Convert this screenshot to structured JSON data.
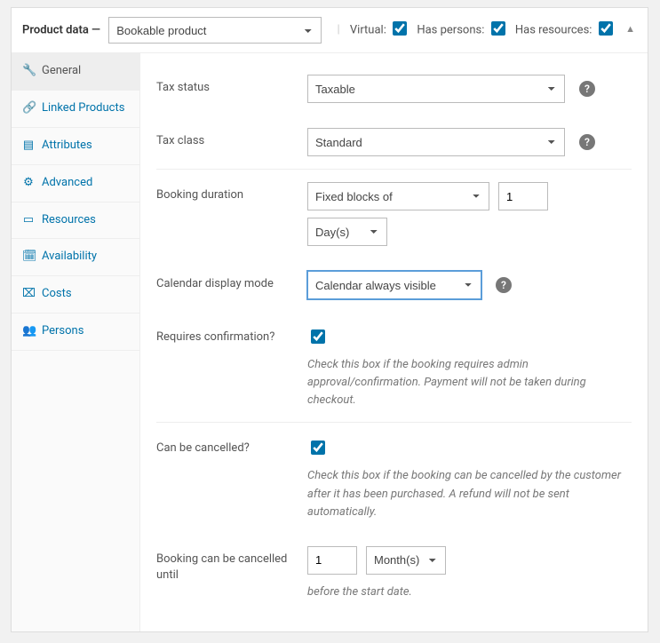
{
  "header": {
    "title": "Product data —",
    "product_type": "Bookable product",
    "options": {
      "virtual_label": "Virtual:",
      "virtual_checked": true,
      "persons_label": "Has persons:",
      "persons_checked": true,
      "resources_label": "Has resources:",
      "resources_checked": true
    }
  },
  "tabs": [
    {
      "id": "general",
      "icon": "wrench",
      "label": "General",
      "active": true
    },
    {
      "id": "linked",
      "icon": "link",
      "label": "Linked Products"
    },
    {
      "id": "attributes",
      "icon": "list",
      "label": "Attributes"
    },
    {
      "id": "advanced",
      "icon": "gear",
      "label": "Advanced"
    },
    {
      "id": "resources",
      "icon": "folder",
      "label": "Resources"
    },
    {
      "id": "availability",
      "icon": "calendar",
      "label": "Availability"
    },
    {
      "id": "costs",
      "icon": "card",
      "label": "Costs"
    },
    {
      "id": "persons",
      "icon": "users",
      "label": "Persons"
    }
  ],
  "fields": {
    "tax_status": {
      "label": "Tax status",
      "value": "Taxable"
    },
    "tax_class": {
      "label": "Tax class",
      "value": "Standard"
    },
    "duration": {
      "label": "Booking duration",
      "mode": "Fixed blocks of",
      "qty": "1",
      "unit": "Day(s)"
    },
    "display_mode": {
      "label": "Calendar display mode",
      "value": "Calendar always visible"
    },
    "confirm": {
      "label": "Requires confirmation?",
      "checked": true,
      "desc": "Check this box if the booking requires admin approval/confirmation. Payment will not be taken during checkout."
    },
    "cancel": {
      "label": "Can be cancelled?",
      "checked": true,
      "desc": "Check this box if the booking can be cancelled by the customer after it has been purchased. A refund will not be sent automatically."
    },
    "cancel_until": {
      "label": "Booking can be cancelled until",
      "qty": "1",
      "unit": "Month(s)",
      "desc": "before the start date."
    }
  }
}
